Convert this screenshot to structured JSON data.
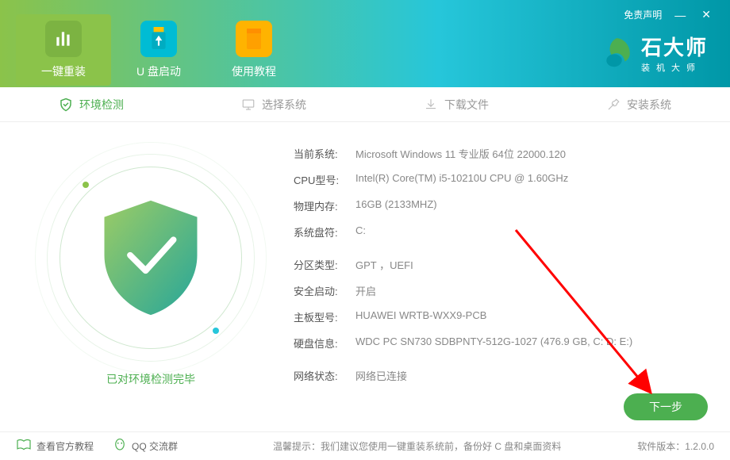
{
  "header": {
    "disclaimer": "免责声明",
    "tabs": [
      {
        "label": "一键重装"
      },
      {
        "label": "U 盘启动"
      },
      {
        "label": "使用教程"
      }
    ],
    "logo_title": "石大师",
    "logo_sub": "装机大师"
  },
  "steps": [
    {
      "label": "环境检测"
    },
    {
      "label": "选择系统"
    },
    {
      "label": "下载文件"
    },
    {
      "label": "安装系统"
    }
  ],
  "shield_status": "已对环境检测完毕",
  "info": {
    "os_label": "当前系统:",
    "os_value": "Microsoft Windows 11 专业版 64位 22000.120",
    "cpu_label": "CPU型号:",
    "cpu_value": "Intel(R) Core(TM) i5-10210U CPU @ 1.60GHz",
    "mem_label": "物理内存:",
    "mem_value": "16GB (2133MHZ)",
    "sysdrive_label": "系统盘符:",
    "sysdrive_value": "C:",
    "part_label": "分区类型:",
    "part_value": "GPT ，UEFI",
    "secure_label": "安全启动:",
    "secure_value": "开启",
    "mb_label": "主板型号:",
    "mb_value": "HUAWEI WRTB-WXX9-PCB",
    "disk_label": "硬盘信息:",
    "disk_value": "WDC PC SN730 SDBPNTY-512G-1027  (476.9 GB, C: D: E:)",
    "net_label": "网络状态:",
    "net_value": "网络已连接"
  },
  "next_btn": "下一步",
  "footer": {
    "tutorial": "查看官方教程",
    "qq": "QQ 交流群",
    "tip": "温馨提示：我们建议您使用一键重装系统前，备份好 C 盘和桌面资料",
    "version_label": "软件版本：",
    "version": "1.2.0.0"
  }
}
